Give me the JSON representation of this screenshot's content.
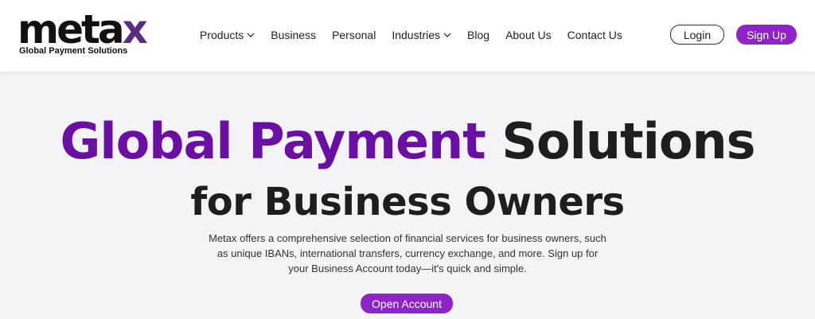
{
  "brand": {
    "logo_main": "meta",
    "logo_x": "x",
    "tagline": "Global Payment Solutions",
    "accent_color": "#8e23c8",
    "headline_color": "#6a0fa3"
  },
  "nav": {
    "items": [
      {
        "label": "Products",
        "icon": "chevron-down-icon"
      },
      {
        "label": "Business"
      },
      {
        "label": "Personal"
      },
      {
        "label": "Industries",
        "icon": "chevron-down-icon"
      },
      {
        "label": "Blog"
      },
      {
        "label": "About Us"
      },
      {
        "label": "Contact Us"
      }
    ],
    "login_label": "Login",
    "signup_label": "Sign Up"
  },
  "hero": {
    "title_accent": "Global Payment",
    "title_rest": "Solutions",
    "title_line2": "for Business Owners",
    "description": "Metax offers a comprehensive selection of financial services for business owners, such as unique IBANs, international transfers, currency exchange, and more. Sign up for your Business Account today—it's quick and simple.",
    "cta_label": "Open Account"
  }
}
